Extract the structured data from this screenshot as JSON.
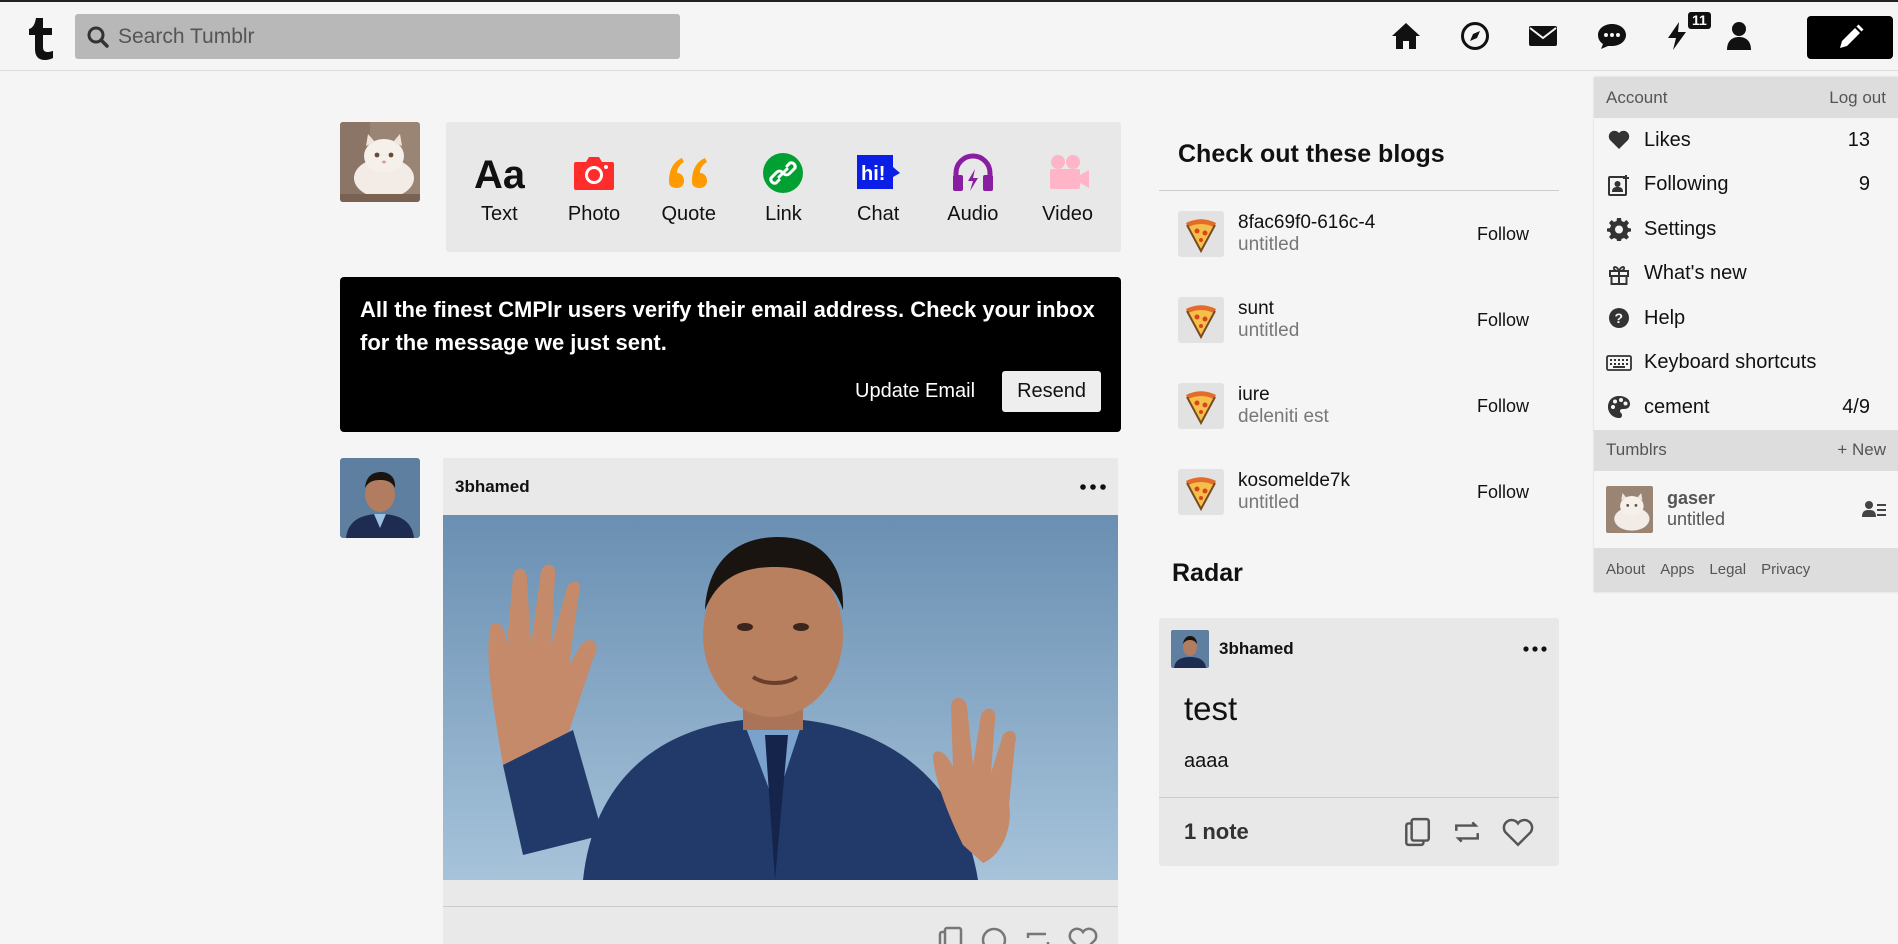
{
  "header": {
    "search_placeholder": "Search Tumblr",
    "activity_badge": "11",
    "nav_icons": [
      "home-icon",
      "explore-icon",
      "inbox-icon",
      "messages-icon",
      "activity-icon",
      "account-icon",
      "compose-icon"
    ]
  },
  "post_types": [
    {
      "label": "Text",
      "icon": "text-icon",
      "color": "#111111"
    },
    {
      "label": "Photo",
      "icon": "photo-icon",
      "color": "#ff2c2c"
    },
    {
      "label": "Quote",
      "icon": "quote-icon",
      "color": "#ff9a00"
    },
    {
      "label": "Link",
      "icon": "link-icon",
      "color": "#00a032"
    },
    {
      "label": "Chat",
      "icon": "chat-icon",
      "color": "#0a1ee6"
    },
    {
      "label": "Audio",
      "icon": "audio-icon",
      "color": "#8a1ea0"
    },
    {
      "label": "Video",
      "icon": "video-icon",
      "color": "#ffb4c8"
    }
  ],
  "verify_banner": {
    "message": "All the finest CMPlr users verify their email address. Check your inbox for the message we just sent.",
    "update_label": "Update Email",
    "resend_label": "Resend"
  },
  "post": {
    "author": "3bhamed"
  },
  "recommended": {
    "title": "Check out these blogs",
    "blogs": [
      {
        "name": "8fac69f0-616c-4",
        "desc": "untitled",
        "follow": "Follow"
      },
      {
        "name": "sunt",
        "desc": "untitled",
        "follow": "Follow"
      },
      {
        "name": "iure",
        "desc": "deleniti est",
        "follow": "Follow"
      },
      {
        "name": "kosomelde7k",
        "desc": "untitled",
        "follow": "Follow"
      }
    ]
  },
  "radar": {
    "title": "Radar",
    "author": "3bhamed",
    "post_title": "test",
    "post_body": "aaaa",
    "notes": "1 note"
  },
  "account_menu": {
    "section_label": "Account",
    "logout_label": "Log out",
    "items": [
      {
        "label": "Likes",
        "count": "13",
        "icon": "heart-icon"
      },
      {
        "label": "Following",
        "count": "9",
        "icon": "following-icon"
      },
      {
        "label": "Settings",
        "count": "",
        "icon": "gear-icon"
      },
      {
        "label": "What's new",
        "count": "",
        "icon": "gift-icon"
      },
      {
        "label": "Help",
        "count": "",
        "icon": "help-icon"
      },
      {
        "label": "Keyboard shortcuts",
        "count": "",
        "icon": "keyboard-icon"
      },
      {
        "label": "cement",
        "count": "4/9",
        "icon": "palette-icon"
      }
    ],
    "tumblrs_label": "Tumblrs",
    "new_label": "+ New",
    "tumblr": {
      "name": "gaser",
      "desc": "untitled"
    },
    "footer_links": [
      "About",
      "Apps",
      "Legal",
      "Privacy"
    ]
  }
}
